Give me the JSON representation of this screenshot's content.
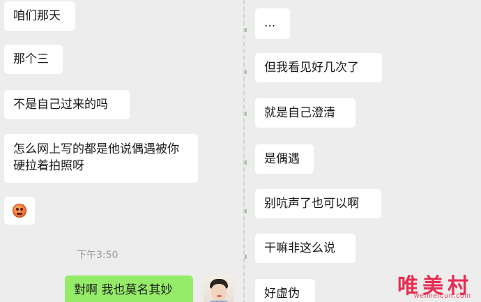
{
  "left_chat": {
    "messages": [
      {
        "text": "咱们那天"
      },
      {
        "text": "那个三"
      },
      {
        "text": "不是自己过来的吗"
      },
      {
        "text": "怎么网上写的都是他说偶遇被你硬拉着拍照呀"
      }
    ],
    "emoji": "flushed-face-emoji",
    "timestamp": "下午3:50",
    "sent_message": "對啊 我也莫名其妙"
  },
  "right_chat": {
    "messages": [
      {
        "text": "..."
      },
      {
        "text": "但我看见好几次了"
      },
      {
        "text": "就是自己澄清"
      },
      {
        "text": "是偶遇"
      },
      {
        "text": "别吭声了也可以啊"
      },
      {
        "text": "干嘛非这么说"
      },
      {
        "text": "好虚伪"
      }
    ]
  },
  "watermark": {
    "text": "唯美村",
    "sub": "weimeicun.com"
  },
  "colors": {
    "background": "#ededed",
    "incoming_bubble": "#ffffff",
    "outgoing_bubble": "#95ec69",
    "timestamp": "#9a9a9a",
    "watermark": "#e62448"
  }
}
